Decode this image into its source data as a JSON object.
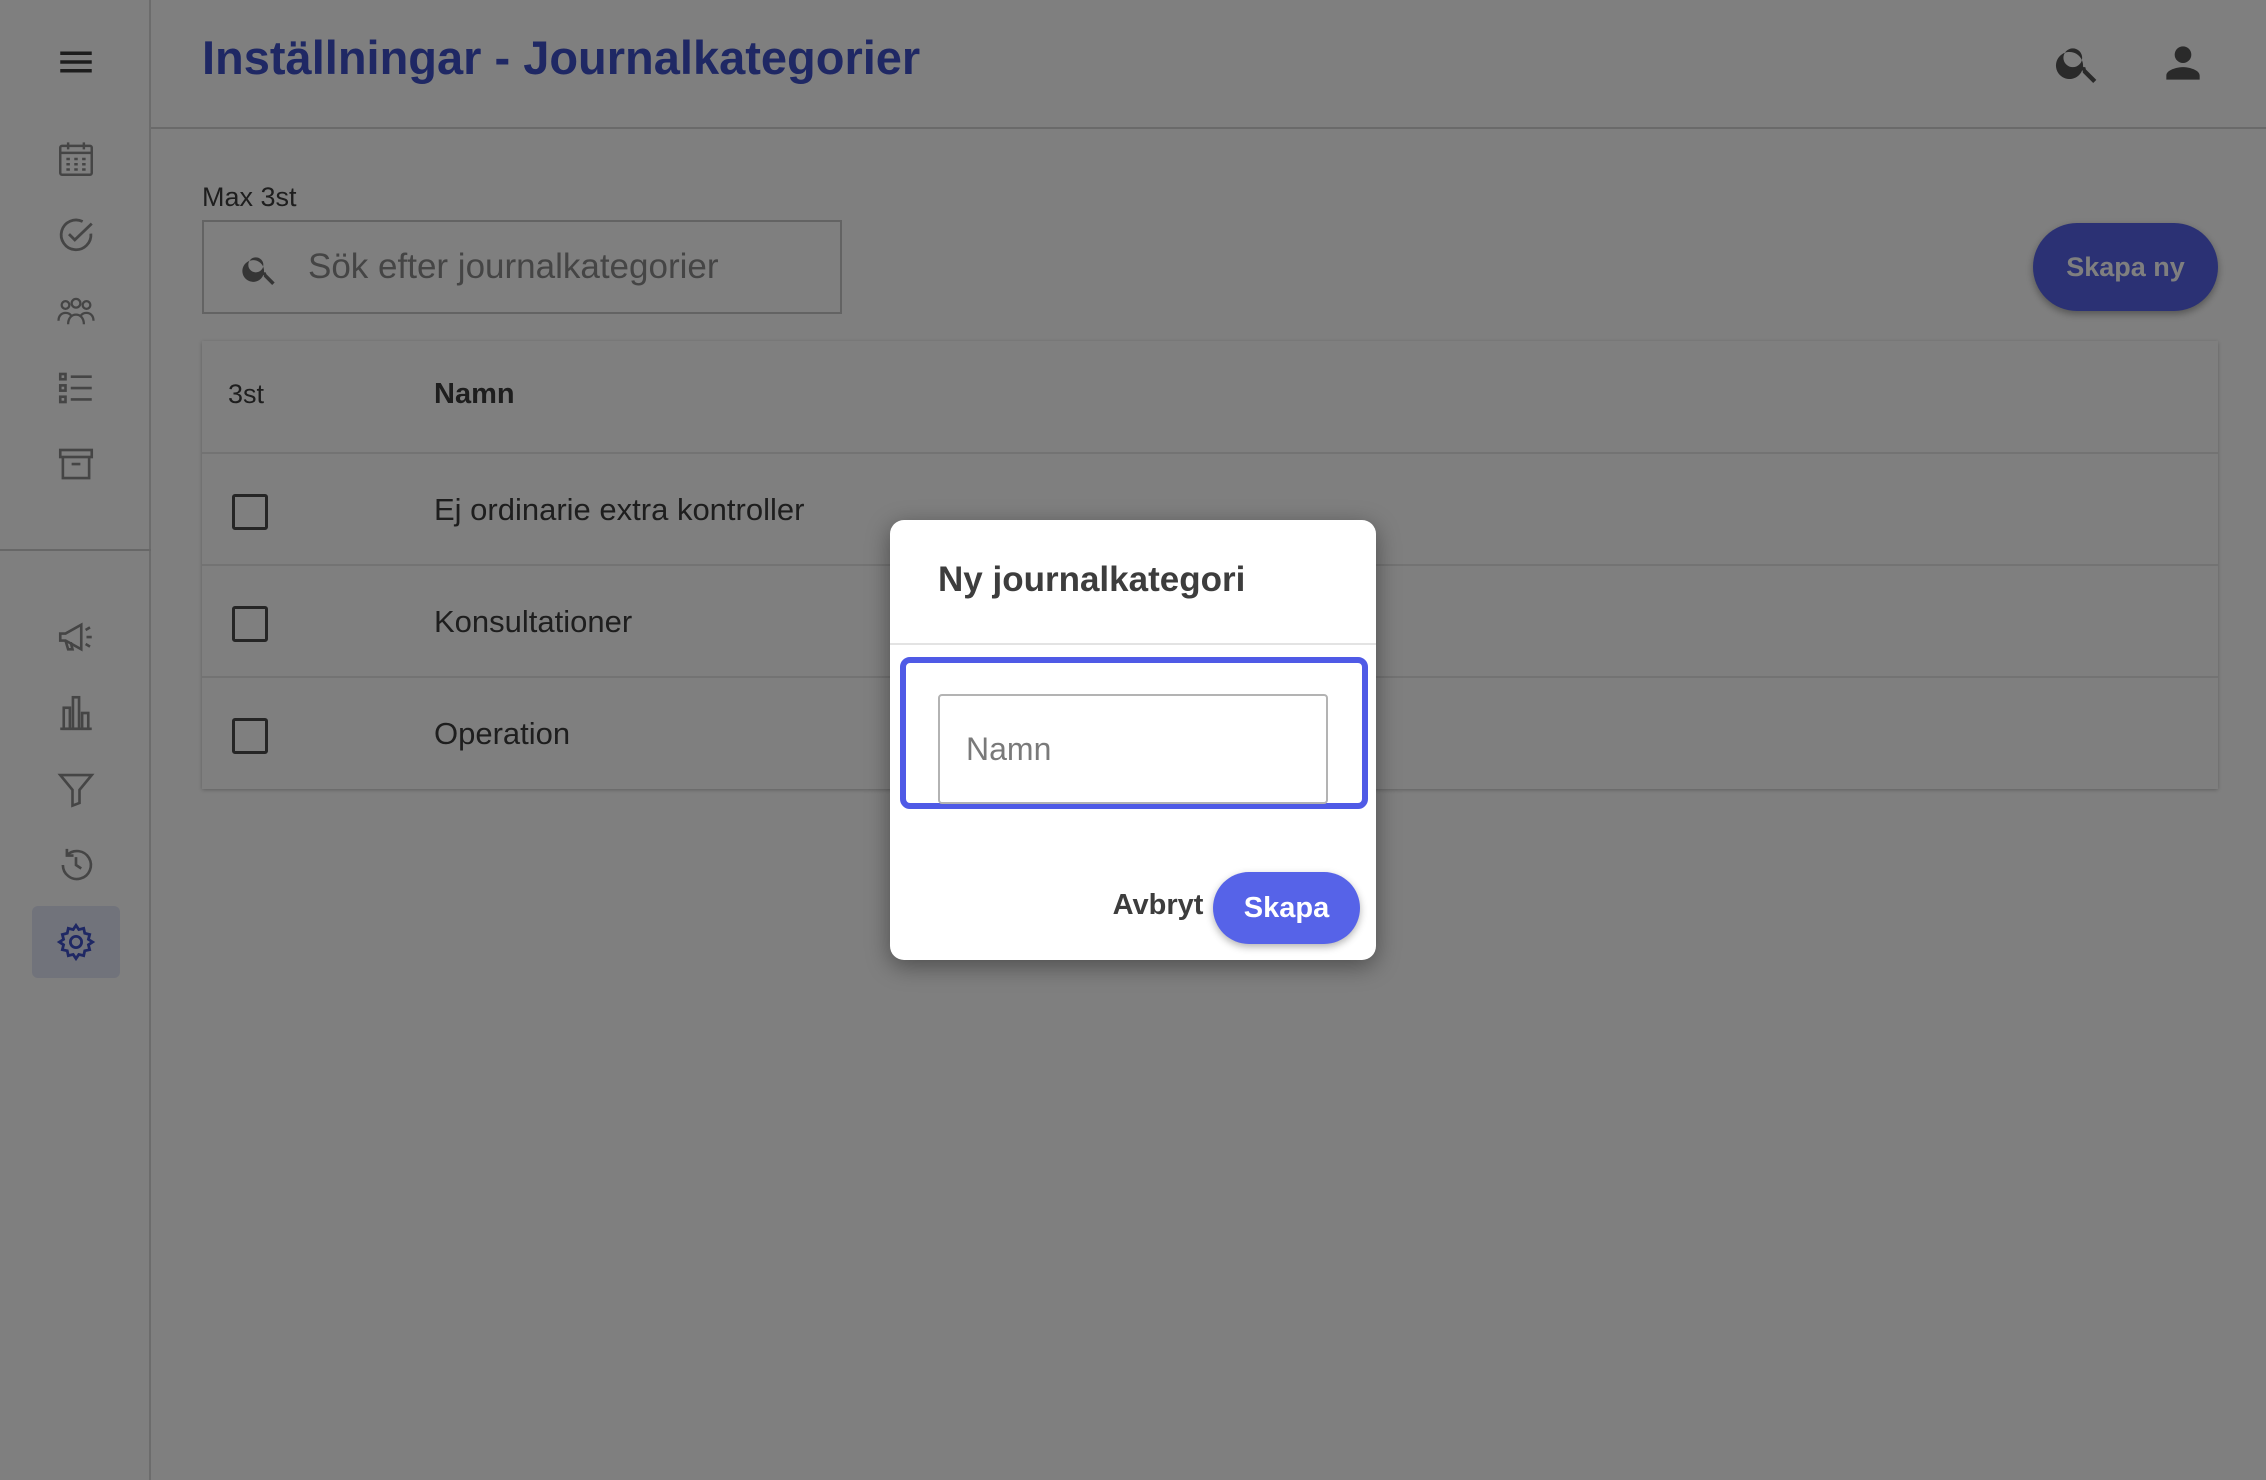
{
  "header": {
    "title": "Inställningar - Journalkategorier"
  },
  "sidebar": {
    "top_items": [
      "menu-icon",
      "calendar-icon",
      "check-circle-icon",
      "people-icon",
      "list-icon",
      "archive-icon"
    ],
    "bottom_items": [
      "megaphone-icon",
      "bar-chart-icon",
      "filter-icon",
      "history-icon",
      "gear-icon"
    ],
    "active_item": "gear-icon"
  },
  "search": {
    "label": "Max 3st",
    "placeholder": "Sök efter journalkategorier",
    "value": ""
  },
  "toolbar": {
    "create_new_label": "Skapa ny"
  },
  "table": {
    "count_header": "3st",
    "name_header": "Namn",
    "rows": [
      {
        "name": "Ej ordinarie extra kontroller",
        "checked": false
      },
      {
        "name": "Konsultationer",
        "checked": false
      },
      {
        "name": "Operation",
        "checked": false
      }
    ]
  },
  "dialog": {
    "title": "Ny journalkategori",
    "name_placeholder": "Namn",
    "name_value": "",
    "cancel_label": "Avbryt",
    "create_label": "Skapa"
  },
  "colors": {
    "accent": "#5663e8",
    "title": "#3f51c9",
    "focus_ring": "#4f5ae6",
    "overlay": "rgba(0,0,0,0.5)"
  }
}
